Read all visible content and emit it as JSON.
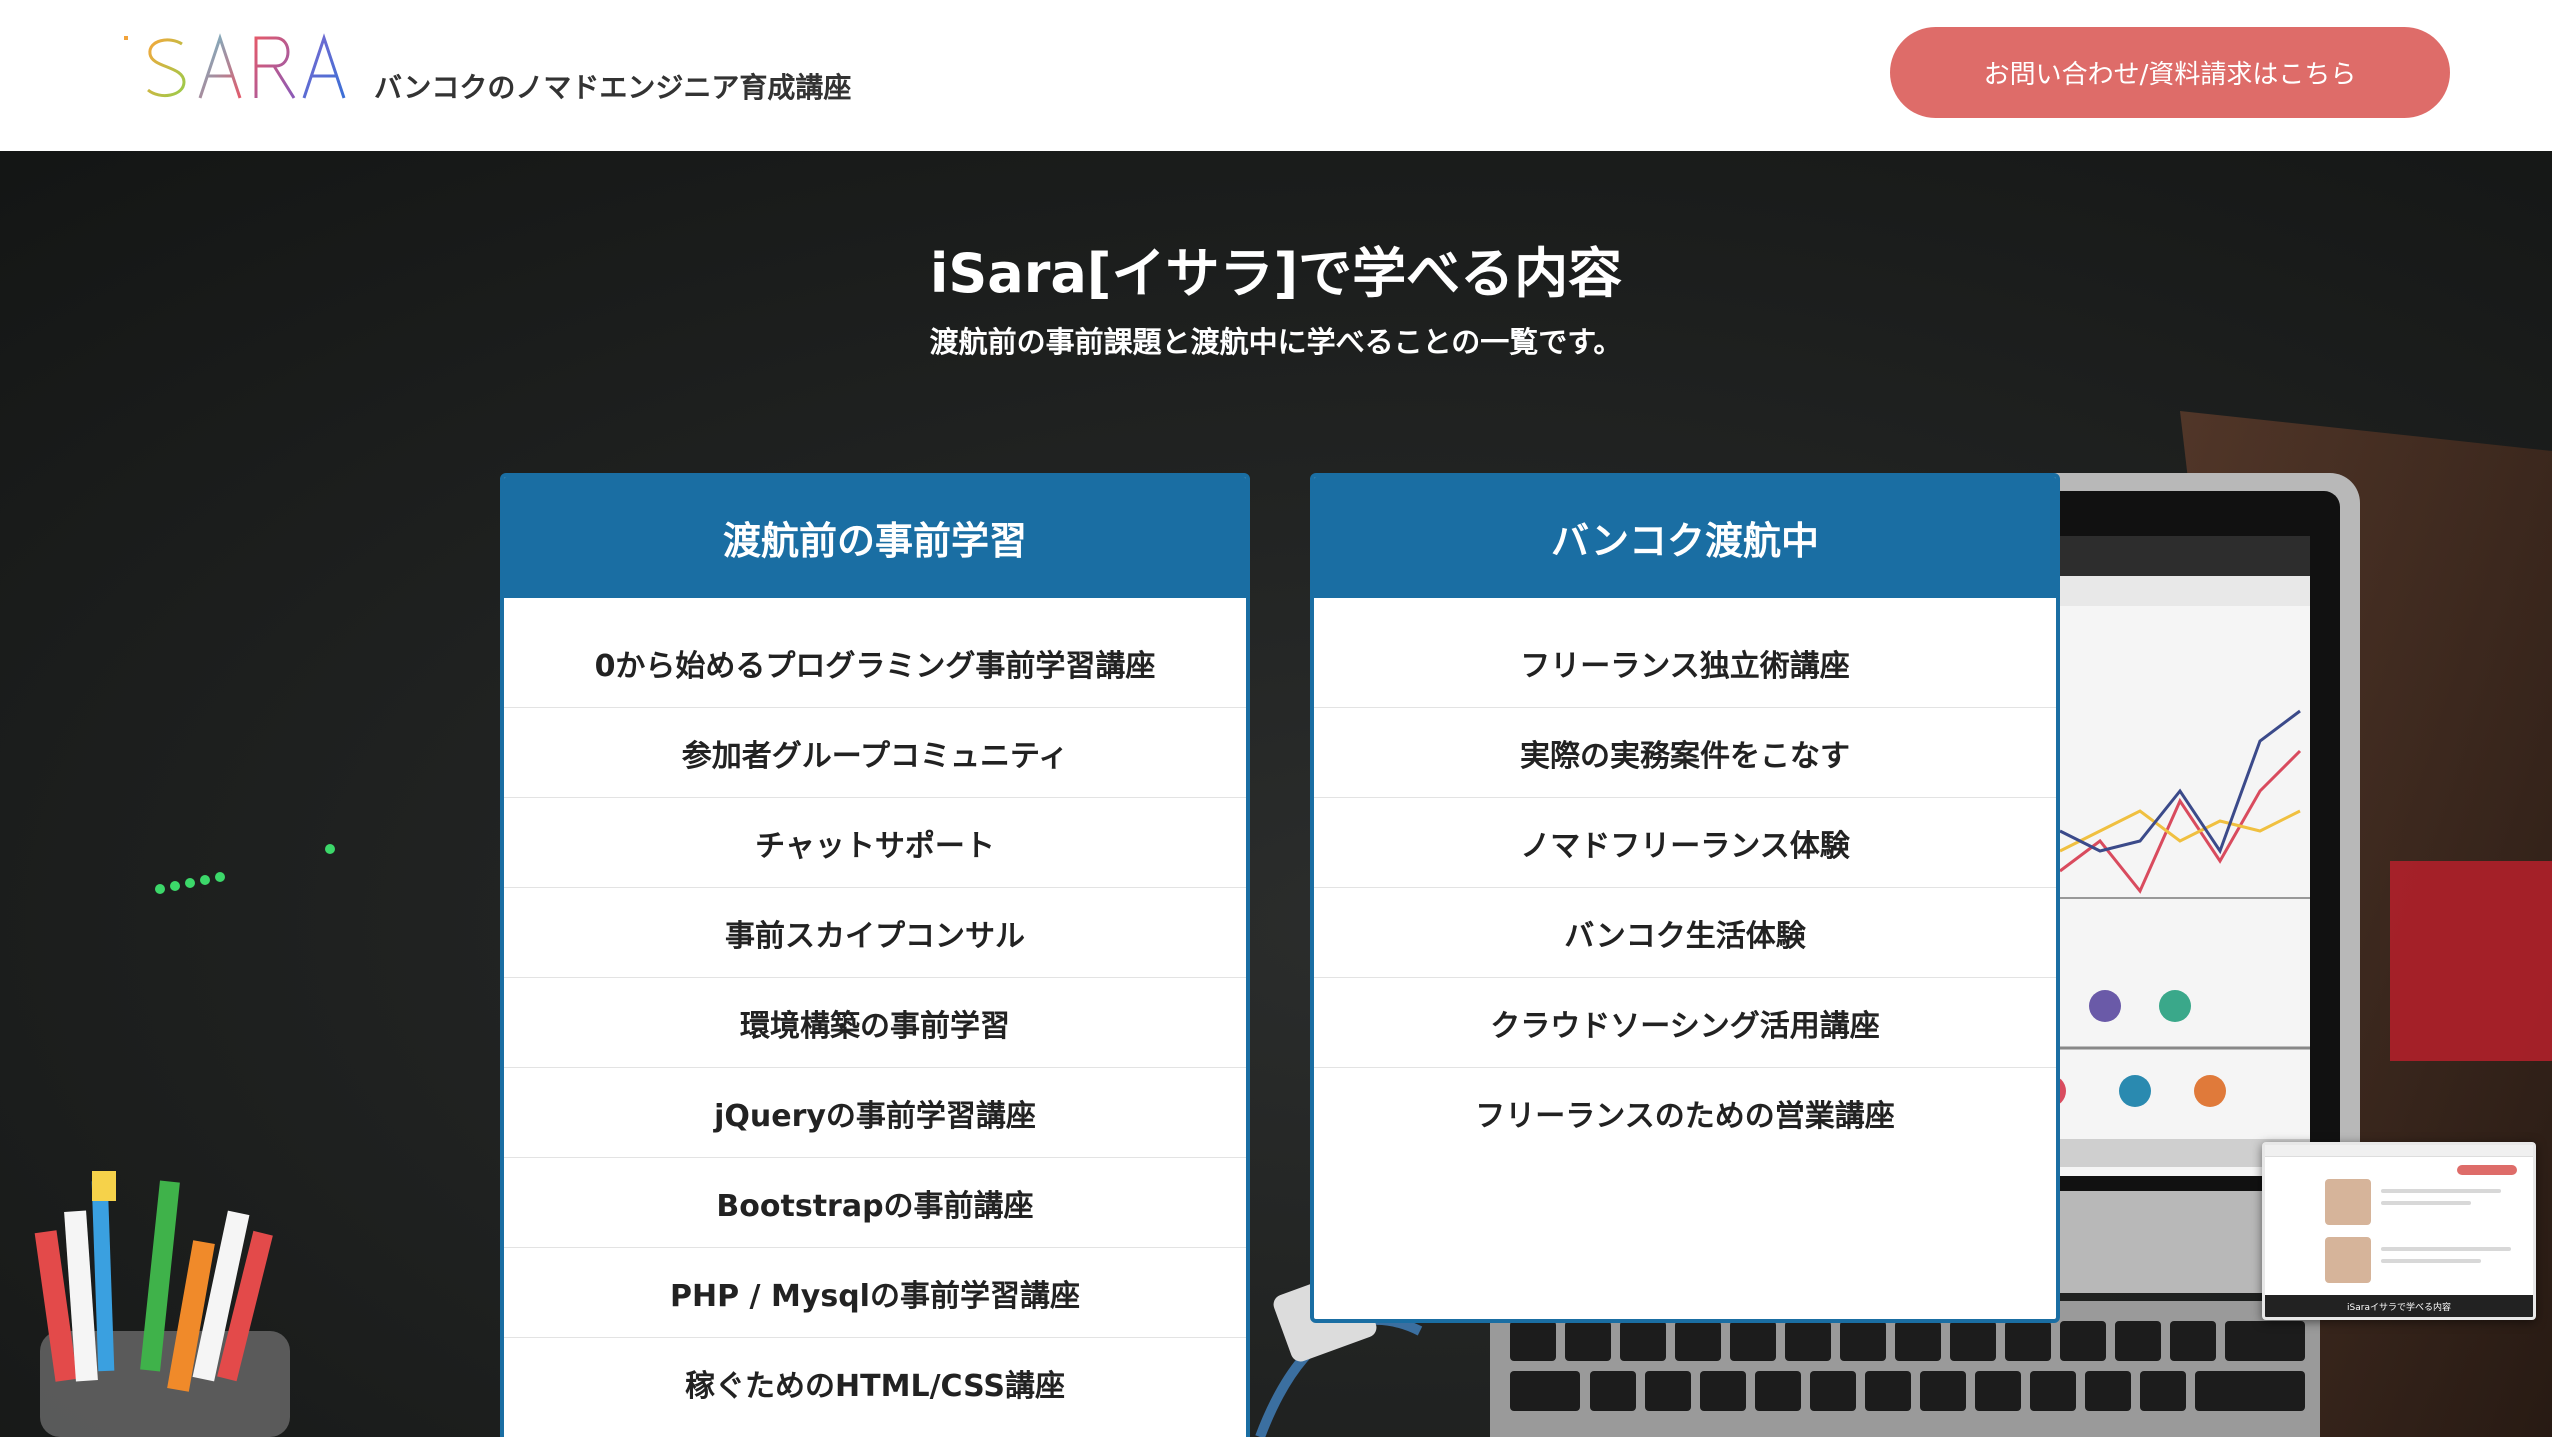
{
  "header": {
    "logo_text": "iSARA",
    "tagline": "バンコクのノマドエンジニア育成講座",
    "cta_label": "お問い合わせ/資料請求はこちら"
  },
  "section": {
    "title": "iSara[イサラ]で学べる内容",
    "subtitle": "渡航前の事前課題と渡航中に学べることの一覧です。"
  },
  "panels": {
    "before": {
      "title": "渡航前の事前学習",
      "items": [
        "0から始めるプログラミング事前学習講座",
        "参加者グループコミュニティ",
        "チャットサポート",
        "事前スカイプコンサル",
        "環境構築の事前学習",
        "jQueryの事前学習講座",
        "Bootstrapの事前講座",
        "PHP / Mysqlの事前学習講座",
        "稼ぐためのHTML/CSS講座"
      ]
    },
    "during": {
      "title": "バンコク渡航中",
      "items": [
        "フリーランス独立術講座",
        "実際の実務案件をこなす",
        "ノマドフリーランス体験",
        "バンコク生活体験",
        "クラウドソーシング活用講座",
        "フリーランスのための営業講座"
      ]
    }
  },
  "thumbnail": {
    "footer_text": "iSaraイサラで学べる内容"
  },
  "colors": {
    "accent_blue": "#1a6ea3",
    "cta_red": "#de6c69",
    "hero_bg": "#1d1f1e"
  }
}
